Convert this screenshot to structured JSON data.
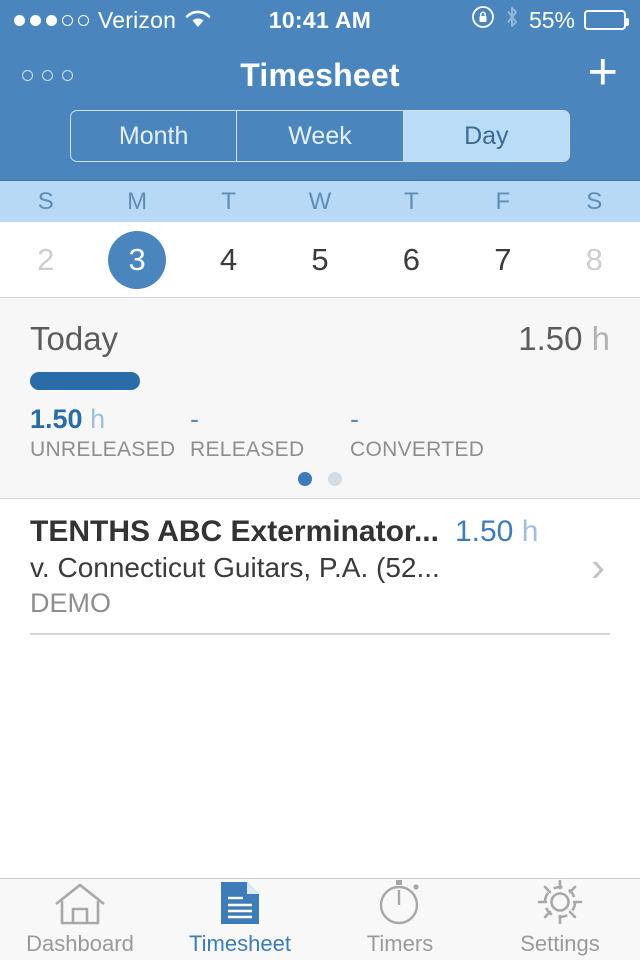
{
  "status_bar": {
    "carrier": "Verizon",
    "signal_filled": 3,
    "signal_total": 5,
    "wifi_icon": "wifi-icon",
    "time": "10:41 AM",
    "rotation_lock_icon": "rotation-lock-icon",
    "bluetooth_icon": "bluetooth-icon",
    "battery_percent": "55%",
    "battery_level": 55,
    "accent": "#4a86bd"
  },
  "nav": {
    "menu_icon": "three-circles-menu-icon",
    "title": "Timesheet",
    "add_icon": "plus-icon"
  },
  "segmented": {
    "options": [
      "Month",
      "Week",
      "Day"
    ],
    "selected": "Day",
    "selected_index": 2
  },
  "calendar": {
    "weekdays": [
      "S",
      "M",
      "T",
      "W",
      "T",
      "F",
      "S"
    ],
    "days": [
      {
        "num": "2",
        "dim": true,
        "selected": false
      },
      {
        "num": "3",
        "dim": false,
        "selected": true
      },
      {
        "num": "4",
        "dim": false,
        "selected": false
      },
      {
        "num": "5",
        "dim": false,
        "selected": false
      },
      {
        "num": "6",
        "dim": false,
        "selected": false
      },
      {
        "num": "7",
        "dim": false,
        "selected": false
      },
      {
        "num": "8",
        "dim": true,
        "selected": false
      }
    ]
  },
  "summary": {
    "label": "Today",
    "total_value": "1.50",
    "total_unit": "h",
    "progress_percent": 100,
    "stats": [
      {
        "value": "1.50",
        "unit": "h",
        "label": "UNRELEASED",
        "empty": false
      },
      {
        "value": "-",
        "unit": "",
        "label": "RELEASED",
        "empty": true
      },
      {
        "value": "-",
        "unit": "",
        "label": "CONVERTED",
        "empty": true
      }
    ],
    "page_dots": 2,
    "page_active": 0
  },
  "entries": [
    {
      "title": "TENTHS ABC Exterminator...",
      "subtitle": "v. Connecticut Guitars, P.A. (52...",
      "tag": "DEMO",
      "hours": "1.50",
      "unit": "h",
      "chevron_icon": "chevron-right-icon"
    }
  ],
  "tabbar": {
    "items": [
      {
        "label": "Dashboard",
        "icon": "home-icon",
        "active": false
      },
      {
        "label": "Timesheet",
        "icon": "document-icon",
        "active": true
      },
      {
        "label": "Timers",
        "icon": "stopwatch-icon",
        "active": false
      },
      {
        "label": "Settings",
        "icon": "gear-icon",
        "active": false
      }
    ]
  }
}
